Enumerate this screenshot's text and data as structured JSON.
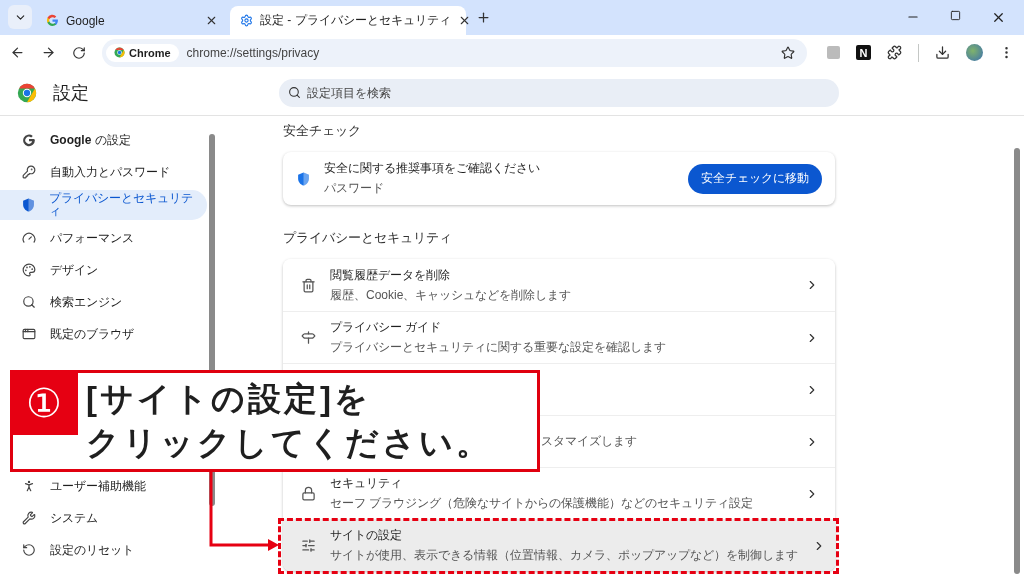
{
  "tabs": [
    {
      "title": "Google",
      "selected": false
    },
    {
      "title": "設定 - プライバシーとセキュリティ",
      "selected": true
    }
  ],
  "address_bar": {
    "chip": "Chrome",
    "url": "chrome://settings/privacy"
  },
  "extensions": [
    {
      "kind": "tile"
    },
    {
      "kind": "letter",
      "label": "N"
    },
    {
      "kind": "puzzle"
    }
  ],
  "header": {
    "title": "設定",
    "search_placeholder": "設定項目を検索"
  },
  "sidebar": {
    "items": [
      {
        "kind": "item",
        "label": "**Google** の設定",
        "selected": false
      },
      {
        "kind": "item",
        "label": "自動入力とパスワード",
        "selected": false
      },
      {
        "kind": "item",
        "label": "プライバシーとセキュリティ",
        "selected": true
      },
      {
        "kind": "item",
        "label": "パフォーマンス",
        "selected": false
      },
      {
        "kind": "item",
        "label": "デザイン",
        "selected": false
      },
      {
        "kind": "item",
        "label": "検索エンジン",
        "selected": false
      },
      {
        "kind": "item",
        "label": "既定のブラウザ",
        "selected": false
      },
      {
        "kind": "hidden"
      },
      {
        "kind": "hidden"
      },
      {
        "kind": "divider"
      },
      {
        "kind": "hidden"
      },
      {
        "kind": "item",
        "label": "ユーザー補助機能",
        "selected": false
      },
      {
        "kind": "item",
        "label": "システム",
        "selected": false
      },
      {
        "kind": "item",
        "label": "設定のリセット",
        "selected": false
      }
    ]
  },
  "safety_check": {
    "heading": "安全チェック",
    "title": "安全に関する推奨事項をご確認ください",
    "subtitle": "パスワード",
    "button": "安全チェックに移動"
  },
  "privacy": {
    "heading": "プライバシーとセキュリティ",
    "rows": [
      {
        "kind": "row",
        "title": "閲覧履歴データを削除",
        "description": "履歴、Cookie、キャッシュなどを削除します",
        "highlighted": false
      },
      {
        "kind": "row",
        "title": "プライバシー ガイド",
        "description": "プライバシーとセキュリティに関する重要な設定を確認します",
        "highlighted": false
      },
      {
        "kind": "covered",
        "highlighted": false
      },
      {
        "kind": "covered",
        "description": "スタマイズします",
        "highlighted": false
      },
      {
        "kind": "row",
        "title": "セキュリティ",
        "description": "セーフ ブラウジング（危険なサイトからの保護機能）などのセキュリティ設定",
        "highlighted": false
      },
      {
        "kind": "row",
        "title": "サイトの設定",
        "description": "サイトが使用、表示できる情報（位置情報、カメラ、ポップアップなど）を制御します",
        "highlighted": true
      }
    ]
  },
  "callout": {
    "number": "①",
    "lines": [
      "[サイトの設定]を",
      "クリックしてください。"
    ]
  }
}
